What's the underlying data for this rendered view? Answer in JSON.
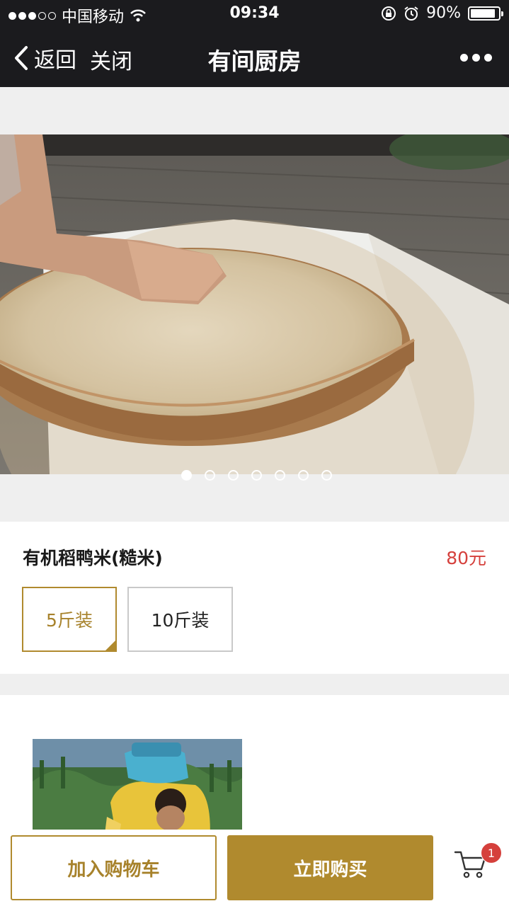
{
  "status_bar": {
    "carrier": "中国移动",
    "time": "09:34",
    "battery": "90%",
    "battery_level": 0.9,
    "icons": [
      "signal-dots",
      "wifi-icon",
      "rotation-lock-icon",
      "alarm-icon",
      "battery-icon"
    ]
  },
  "nav": {
    "back_label": "返回",
    "close_label": "关闭",
    "title": "有间厨房",
    "more_icon": "ellipsis-icon"
  },
  "carousel": {
    "total": 7,
    "active_index": 0
  },
  "product": {
    "name": "有机稻鸭米(糙米)",
    "price": "80元",
    "options": [
      {
        "label": "5斤装",
        "selected": true
      },
      {
        "label": "10斤装",
        "selected": false
      }
    ]
  },
  "bottom_bar": {
    "add_to_cart_label": "加入购物车",
    "buy_now_label": "立即购买",
    "cart_count": "1"
  },
  "colors": {
    "accent": "#b08a2e",
    "price": "#d5403c",
    "header_bg": "#1b1b1e"
  }
}
